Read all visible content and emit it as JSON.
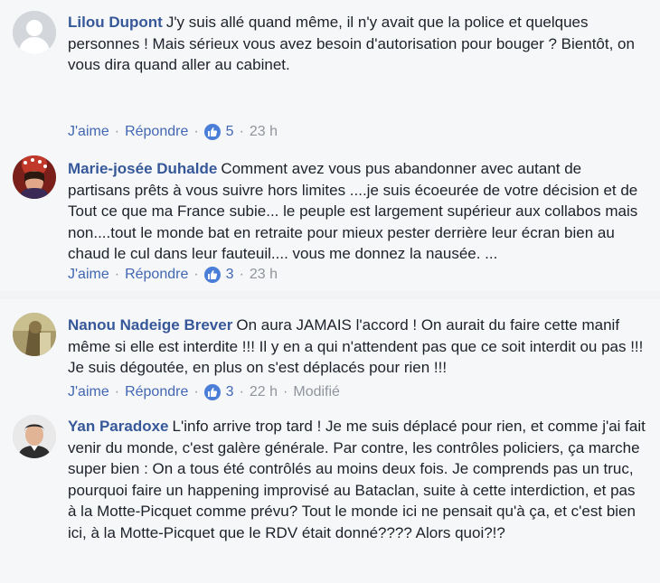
{
  "comments": [
    {
      "author": "Lilou Dupont",
      "text": "J'y suis allé quand même, il n'y avait que la police et quelques personnes ! Mais sérieux vous avez besoin d'autorisation pour bouger ? Bientôt, on vous dira quand aller au cabinet.",
      "like_label": "J'aime",
      "reply_label": "Répondre",
      "reactions": "5",
      "time": "23 h",
      "avatar": "default-avatar-icon"
    },
    {
      "author": "Marie-josée Duhalde",
      "text": "Comment avez vous pus abandonner avec autant de partisans prêts à vous suivre hors limites ....je suis écoeurée de votre décision et de Tout ce que ma France subie... le peuple est largement supérieur aux collabos mais non....tout le monde bat en retraite pour mieux pester derrière leur écran bien au chaud le cul dans leur fauteuil.... vous me donnez la nausée. ...",
      "like_label": "J'aime",
      "reply_label": "Répondre",
      "reactions": "3",
      "time": "23 h",
      "avatar": "user-photo"
    },
    {
      "author": "Nanou Nadeige Brever",
      "text": "On aura JAMAIS l'accord ! On aurait du faire cette manif même si elle est interdite !!! Il y en a qui n'attendent pas que ce soit interdit ou pas !!! Je suis dégoutée, en plus on s'est déplacés pour rien !!!",
      "like_label": "J'aime",
      "reply_label": "Répondre",
      "reactions": "3",
      "time": "22 h",
      "edited": "Modifié",
      "avatar": "user-photo"
    },
    {
      "author": "Yan Paradoxe",
      "text": "L'info arrive trop tard ! Je me suis déplacé pour rien, et comme j'ai fait venir du monde, c'est galère générale. Par contre, les contrôles policiers, ça marche super bien : On a tous été contrôlés au moins deux fois. Je comprends pas un truc, pourquoi faire un happening improvisé au Bataclan, suite à cette interdiction, et pas à la Motte-Picquet comme prévu? Tout le monde ici ne pensait qu'à ça, et c'est bien ici, à la Motte-Picquet que le RDV était donné???? Alors quoi?!?",
      "avatar": "user-photo"
    }
  ],
  "colors": {
    "author": "#365899",
    "link": "#4267b2",
    "muted": "#90949c",
    "like_badge": "#4a7ed8"
  }
}
